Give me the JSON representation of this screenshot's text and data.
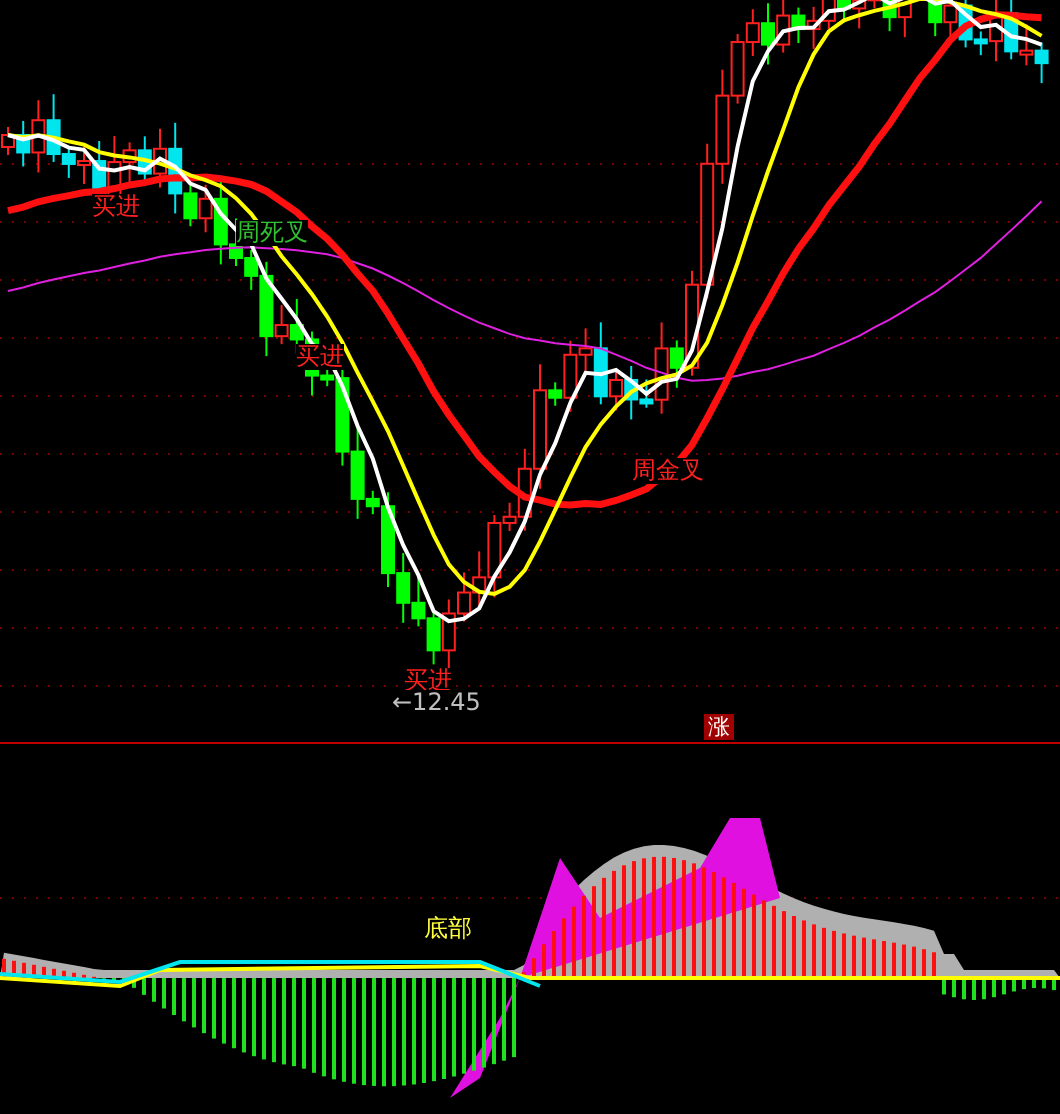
{
  "main_panel": {
    "signals": [
      {
        "text": "买进"
      },
      {
        "text": "买进"
      },
      {
        "text": "买进"
      }
    ],
    "crosses": [
      {
        "text": "周死叉",
        "kind": "death"
      },
      {
        "text": "周金叉",
        "kind": "golden"
      }
    ],
    "price_marker": "←12.45"
  },
  "divider_badge": "涨",
  "indicator_panel": {
    "label": "底部"
  }
}
